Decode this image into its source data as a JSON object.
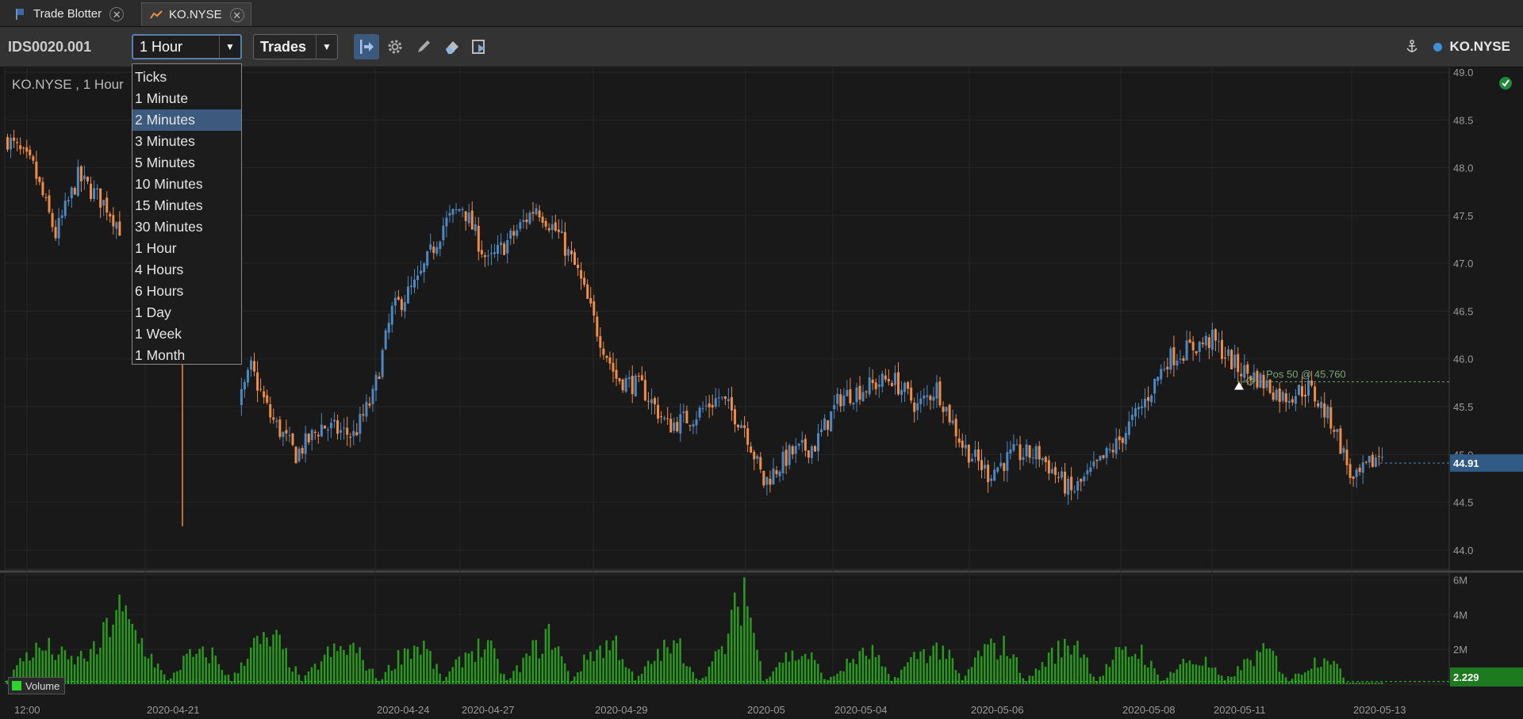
{
  "tabs": [
    {
      "label": "Trade Blotter"
    },
    {
      "label": "KO.NYSE"
    }
  ],
  "toolbar": {
    "id": "IDS0020.001",
    "interval": "1 Hour",
    "type": "Trades",
    "symbol": "KO.NYSE"
  },
  "dropdown": {
    "options": [
      "Ticks",
      "1 Minute",
      "2 Minutes",
      "3 Minutes",
      "5 Minutes",
      "10 Minutes",
      "15 Minutes",
      "30 Minutes",
      "1 Hour",
      "4 Hours",
      "6 Hours",
      "1 Day",
      "1 Week",
      "1 Month"
    ],
    "highlighted": "2 Minutes"
  },
  "chart": {
    "title": "KO.NYSE , 1 Hour",
    "position_label": "Pos 50 @ 45.760",
    "last_price": "44.91",
    "last_volume": "2.229",
    "volume_legend": "Volume"
  },
  "colors": {
    "up": "#4e88c2",
    "down": "#f08c46",
    "volume": "#2a9a1f",
    "highlight": "#3c5a7e"
  },
  "chart_data": {
    "type": "candlestick",
    "price_axis": {
      "ticks": [
        "44.0",
        "44.5",
        "45.0",
        "45.5",
        "46.0",
        "46.5",
        "47.0",
        "47.5",
        "48.0",
        "48.5",
        "49.0"
      ],
      "ylim": [
        43.8,
        49.05
      ]
    },
    "volume_axis": {
      "ticks": [
        "2M",
        "4M",
        "6M"
      ],
      "ylim": [
        0,
        6.3
      ]
    },
    "x_labels": [
      "12:00",
      "2020-04-21",
      "2020-04-24",
      "2020-04-27",
      "2020-04-29",
      "2020-05",
      "2020-05-04",
      "2020-05-06",
      "2020-05-08",
      "2020-05-11",
      "2020-05-13"
    ],
    "close_path": [
      [
        0,
        48.3
      ],
      [
        8,
        48.0
      ],
      [
        15,
        47.3
      ],
      [
        22,
        47.9
      ],
      [
        31,
        47.6
      ],
      [
        38,
        47.2
      ],
      [
        45,
        45.8
      ],
      [
        55,
        45.7
      ],
      [
        62,
        45.5
      ],
      [
        70,
        45.3
      ],
      [
        76,
        45.9
      ],
      [
        82,
        45.4
      ],
      [
        90,
        45.0
      ],
      [
        98,
        45.3
      ],
      [
        108,
        45.2
      ],
      [
        114,
        45.6
      ],
      [
        120,
        46.5
      ],
      [
        128,
        46.8
      ],
      [
        136,
        47.4
      ],
      [
        142,
        47.6
      ],
      [
        150,
        47.0
      ],
      [
        158,
        47.3
      ],
      [
        165,
        47.6
      ],
      [
        172,
        47.3
      ],
      [
        178,
        46.9
      ],
      [
        184,
        46.3
      ],
      [
        190,
        45.8
      ],
      [
        198,
        45.7
      ],
      [
        206,
        45.3
      ],
      [
        214,
        45.4
      ],
      [
        222,
        45.6
      ],
      [
        230,
        45.3
      ],
      [
        236,
        44.7
      ],
      [
        244,
        45.0
      ],
      [
        252,
        45.1
      ],
      [
        260,
        45.6
      ],
      [
        268,
        45.7
      ],
      [
        276,
        45.8
      ],
      [
        284,
        45.5
      ],
      [
        290,
        45.7
      ],
      [
        298,
        45.1
      ],
      [
        306,
        44.8
      ],
      [
        314,
        45.0
      ],
      [
        322,
        45.0
      ],
      [
        332,
        44.6
      ],
      [
        338,
        44.8
      ],
      [
        346,
        45.1
      ],
      [
        354,
        45.5
      ],
      [
        362,
        46.0
      ],
      [
        368,
        46.1
      ],
      [
        376,
        46.2
      ],
      [
        384,
        45.9
      ],
      [
        390,
        45.8
      ],
      [
        398,
        45.6
      ],
      [
        406,
        45.7
      ],
      [
        414,
        45.3
      ],
      [
        420,
        44.7
      ],
      [
        428,
        45.0
      ]
    ],
    "volume_profile": [
      [
        0,
        0.3
      ],
      [
        6,
        1.8
      ],
      [
        12,
        2.2
      ],
      [
        20,
        1.4
      ],
      [
        28,
        2.0
      ],
      [
        34,
        4.6
      ],
      [
        42,
        2.5
      ],
      [
        50,
        0.2
      ],
      [
        56,
        1.6
      ],
      [
        64,
        1.8
      ],
      [
        70,
        0.2
      ],
      [
        76,
        2.3
      ],
      [
        84,
        2.6
      ],
      [
        92,
        0.2
      ],
      [
        100,
        1.8
      ],
      [
        108,
        2.2
      ],
      [
        116,
        0.2
      ],
      [
        124,
        2.1
      ],
      [
        130,
        2.3
      ],
      [
        136,
        0.2
      ],
      [
        144,
        2.0
      ],
      [
        150,
        2.3
      ],
      [
        156,
        0.2
      ],
      [
        164,
        2.0
      ],
      [
        170,
        3.0
      ],
      [
        176,
        0.2
      ],
      [
        182,
        1.9
      ],
      [
        190,
        2.5
      ],
      [
        196,
        0.2
      ],
      [
        204,
        2.0
      ],
      [
        210,
        2.2
      ],
      [
        216,
        0.2
      ],
      [
        224,
        2.3
      ],
      [
        230,
        6.0
      ],
      [
        236,
        0.2
      ],
      [
        242,
        1.6
      ],
      [
        250,
        1.8
      ],
      [
        256,
        0.2
      ],
      [
        264,
        1.5
      ],
      [
        270,
        1.9
      ],
      [
        276,
        0.2
      ],
      [
        284,
        1.8
      ],
      [
        292,
        2.2
      ],
      [
        298,
        0.2
      ],
      [
        304,
        2.0
      ],
      [
        312,
        2.3
      ],
      [
        318,
        0.2
      ],
      [
        326,
        1.8
      ],
      [
        334,
        2.6
      ],
      [
        340,
        0.2
      ],
      [
        346,
        1.7
      ],
      [
        354,
        2.0
      ],
      [
        360,
        0.2
      ],
      [
        368,
        1.4
      ],
      [
        374,
        1.3
      ],
      [
        380,
        0.2
      ],
      [
        388,
        1.5
      ],
      [
        394,
        2.0
      ],
      [
        400,
        0.2
      ],
      [
        406,
        1.1
      ],
      [
        412,
        1.9
      ],
      [
        418,
        0.1
      ],
      [
        428,
        0.1
      ]
    ]
  }
}
